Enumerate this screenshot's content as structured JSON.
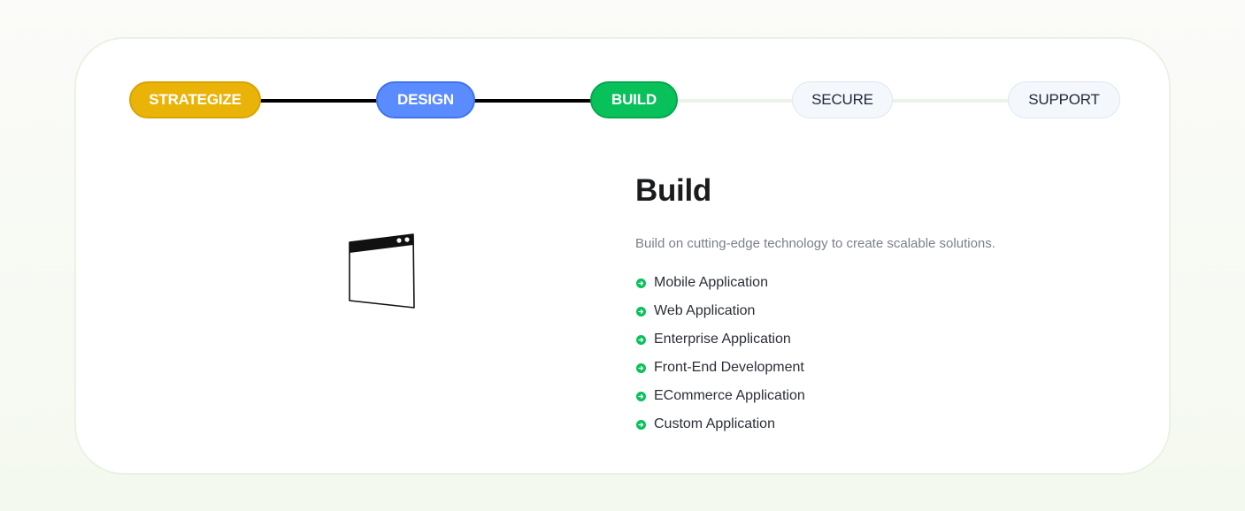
{
  "stepper": {
    "steps": [
      {
        "label": "STRATEGIZE",
        "status": "completed",
        "color": "#eab308"
      },
      {
        "label": "DESIGN",
        "status": "completed",
        "color": "#5b8cff"
      },
      {
        "label": "BUILD",
        "status": "active",
        "color": "#09c15a"
      },
      {
        "label": "SECURE",
        "status": "upcoming",
        "color": "#f4f7fb"
      },
      {
        "label": "SUPPORT",
        "status": "upcoming",
        "color": "#f4f7fb"
      }
    ]
  },
  "illustration": {
    "icon": "browser-window-icon"
  },
  "content": {
    "title": "Build",
    "description": "Build on cutting-edge technology to create scalable solutions.",
    "bullet_icon": "arrow-circle-icon",
    "bullet_color": "#09c15a",
    "features": [
      "Mobile Application",
      "Web Application",
      "Enterprise Application",
      "Front-End Development",
      "ECommerce Application",
      "Custom Application"
    ]
  }
}
